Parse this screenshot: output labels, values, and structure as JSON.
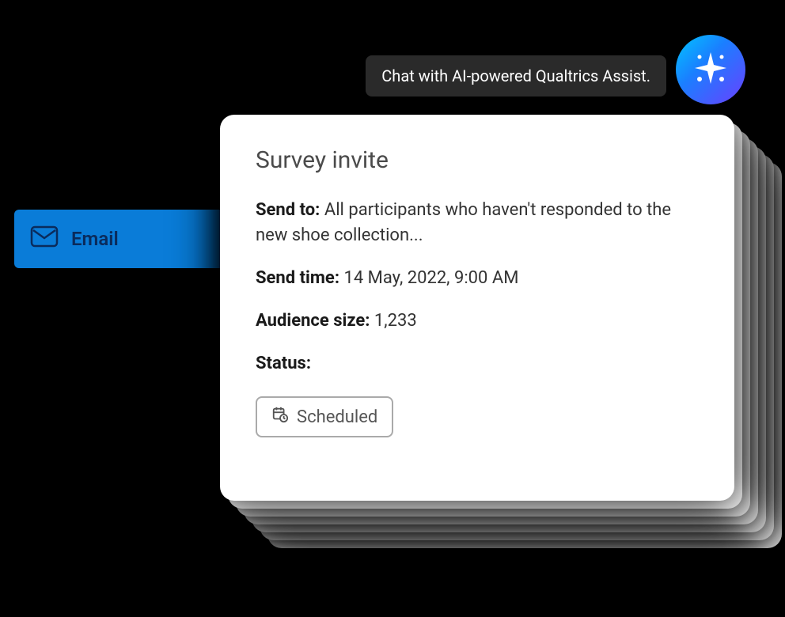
{
  "tooltip": {
    "text": "Chat with AI-powered Qualtrics Assist."
  },
  "tab": {
    "label": "Email"
  },
  "card": {
    "title": "Survey invite",
    "send_to_label": "Send to:",
    "send_to_value": "All participants who haven't responded to the new shoe collection...",
    "send_time_label": "Send time:",
    "send_time_value": "14 May, 2022, 9:00 AM",
    "audience_size_label": "Audience size:",
    "audience_size_value": "1,233",
    "status_label": "Status:",
    "status_value": "Scheduled"
  }
}
